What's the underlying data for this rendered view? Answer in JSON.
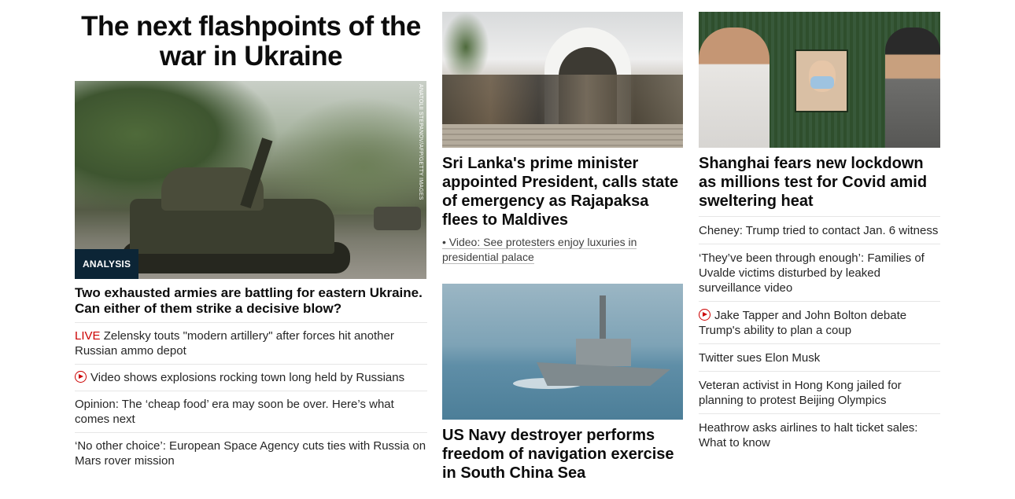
{
  "left": {
    "section_title": "The next flashpoints of the war in Ukraine",
    "image_credit": "ANATOLII STEPANOV/AFP/GETTY IMAGES",
    "badge": "ANALYSIS",
    "headline": "Two exhausted armies are battling for eastern Ukraine. Can either of them strike a decisive blow?",
    "items": [
      {
        "prefix": "LIVE",
        "text": " Zelensky touts \"modern artillery\" after forces hit another Russian ammo depot",
        "type": "live"
      },
      {
        "text": "Video shows explosions rocking town long held by Russians",
        "type": "video"
      },
      {
        "text": "Opinion: The ‘cheap food’ era may soon be over. Here’s what comes next",
        "type": "plain"
      },
      {
        "text": "‘No other choice’: European Space Agency cuts ties with Russia on Mars rover mission",
        "type": "plain"
      }
    ]
  },
  "middle": {
    "story1": {
      "headline": "Sri Lanka's prime minister appointed President, calls state of emergency as Rajapaksa flees to Maldives",
      "sub_link": "• Video: See protesters enjoy luxuries in presidential palace"
    },
    "story2": {
      "headline": "US Navy destroyer performs freedom of navigation exercise in South China Sea"
    }
  },
  "right": {
    "headline": "Shanghai fears new lockdown as millions test for Covid amid sweltering heat",
    "items": [
      {
        "text": "Cheney: Trump tried to contact Jan. 6 witness",
        "type": "plain"
      },
      {
        "text": "‘They’ve been through enough’: Families of Uvalde victims disturbed by leaked surveillance video",
        "type": "plain"
      },
      {
        "text": "Jake Tapper and John Bolton debate Trump's ability to plan a coup",
        "type": "video"
      },
      {
        "text": "Twitter sues Elon Musk",
        "type": "plain"
      },
      {
        "text": "Veteran activist in Hong Kong jailed for planning to protest Beijing Olympics",
        "type": "plain"
      },
      {
        "text": "Heathrow asks airlines to halt ticket sales: What to know",
        "type": "plain"
      }
    ]
  },
  "colors": {
    "live": "#cc0000",
    "badge_bg": "#0c2536",
    "divider": "#e6e6e6"
  }
}
